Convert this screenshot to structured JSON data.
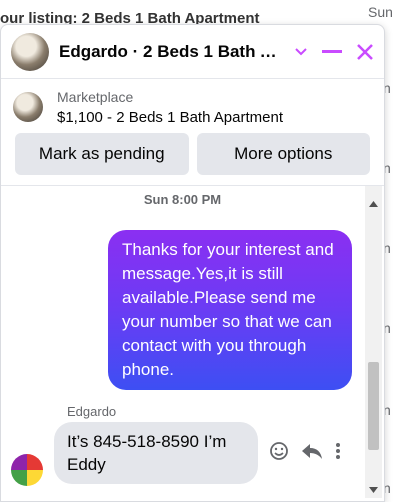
{
  "background": {
    "title": "our listing: 2 Beds 1 Bath Apartment",
    "sun": "Sun",
    "n": "n"
  },
  "chat": {
    "title": "Edgardo · 2 Beds 1 Bath Apartment",
    "listing_source": "Marketplace",
    "listing_name": "$1,100 - 2 Beds 1 Bath Apartment",
    "mark_pending": "Mark as pending",
    "more_options": "More options",
    "timestamp": "Sun 8:00 PM",
    "outgoing": "Thanks for your interest and message.Yes,it is still available.Please send me your number so that we can contact with you through phone.",
    "sender": "Edgardo",
    "incoming": "It’s 845-518-8590 I’m Eddy"
  },
  "colors": {
    "accent": "#c94bff",
    "bubble_start": "#8b2ff2",
    "bubble_end": "#3d4ff3"
  }
}
